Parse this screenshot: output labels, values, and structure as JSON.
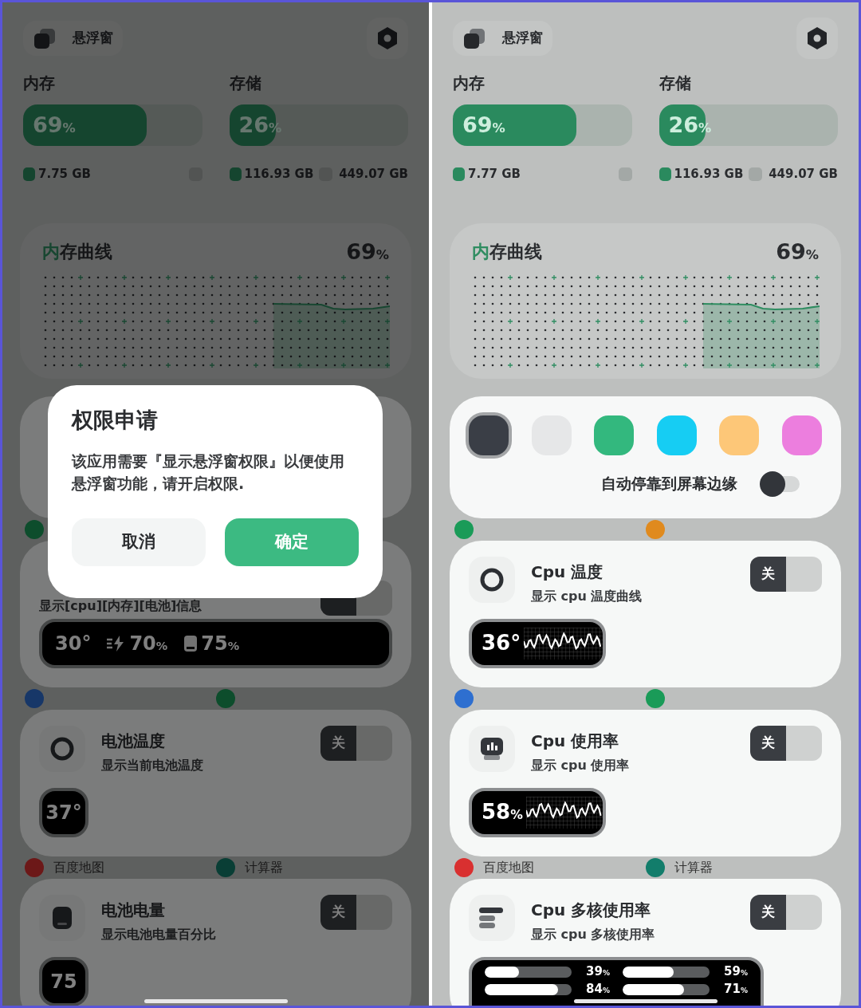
{
  "panels": [
    {
      "dimmed": true,
      "header": {
        "title": "悬浮窗"
      },
      "memory": {
        "label": "内存",
        "level": 0.69,
        "value": "69",
        "unit": "%",
        "used": "7.75 GB"
      },
      "storage": {
        "label": "存储",
        "level": 0.26,
        "value": "26",
        "unit": "%",
        "used": "116.93 GB",
        "total": "449.07 GB"
      },
      "curve": {
        "title": "内存曲线",
        "value": "69",
        "unit": "%"
      },
      "sections": [
        {
          "kind": "blank"
        },
        {
          "kind": "apps",
          "apps": [
            {
              "color": "#0d4d2c"
            }
          ]
        },
        {
          "kind": "widget",
          "subtitle": "显示[cpu][内存][电池]信息",
          "toggle": {
            "on": false
          },
          "preview": {
            "kind": "combo",
            "segments": [
              {
                "kind": "temp",
                "value": "30°"
              },
              {
                "kind": "charge",
                "value": "70",
                "unit": "%"
              },
              {
                "kind": "battery",
                "value": "75",
                "unit": "%"
              }
            ]
          }
        },
        {
          "kind": "apps",
          "apps": [
            {
              "color": "#173768"
            },
            {
              "color": "#0d4d2c"
            }
          ]
        },
        {
          "kind": "ring",
          "title": "电池温度",
          "subtitle": "显示当前电池温度",
          "toggle": {
            "on": false,
            "label": "关"
          },
          "preview": {
            "kind": "badge",
            "value": "37°"
          }
        },
        {
          "kind": "apps",
          "apps": [
            {
              "color": "#6c1818",
              "label": "百度地图"
            },
            {
              "color": "#093e35",
              "label": "计算器"
            }
          ]
        },
        {
          "kind": "battery",
          "title": "电池电量",
          "subtitle": "显示电池电量百分比",
          "toggle": {
            "on": false,
            "label": "关"
          },
          "preview": {
            "kind": "badge",
            "value": "75"
          }
        }
      ],
      "dialog": {
        "title": "权限申请",
        "body": "该应用需要『显示悬浮窗权限』以便使用悬浮窗功能，请开启权限.",
        "buttons": [
          {
            "label": "取消",
            "kind": "secondary"
          },
          {
            "label": "确定",
            "kind": "primary"
          }
        ]
      }
    },
    {
      "dimmed": false,
      "header": {
        "title": "悬浮窗"
      },
      "memory": {
        "label": "内存",
        "level": 0.69,
        "value": "69",
        "unit": "%",
        "used": "7.77 GB"
      },
      "storage": {
        "label": "存储",
        "level": 0.26,
        "value": "26",
        "unit": "%",
        "used": "116.93 GB",
        "total": "449.07 GB"
      },
      "curve": {
        "title": "内存曲线",
        "value": "69",
        "unit": "%"
      },
      "sections": [
        {
          "kind": "swatches",
          "swatches": [
            {
              "color": "#3a3e46",
              "selected": true
            },
            {
              "color": "#e6e7e8",
              "selected": false
            },
            {
              "color": "#33b87e",
              "selected": false
            },
            {
              "color": "#16cdf3",
              "selected": false
            },
            {
              "color": "#fdc778",
              "selected": false
            },
            {
              "color": "#ec7ede",
              "selected": false
            }
          ],
          "dock": {
            "label": "自动停靠到屏幕边缘",
            "on": false
          }
        },
        {
          "kind": "apps",
          "apps": [
            {
              "color": "#1a9b58"
            },
            {
              "color": "#e08a1e"
            }
          ]
        },
        {
          "kind": "ring",
          "title": "Cpu 温度",
          "subtitle": "显示 cpu 温度曲线",
          "toggle": {
            "on": false,
            "label": "关"
          },
          "preview": {
            "kind": "wave",
            "value": "36°"
          }
        },
        {
          "kind": "apps",
          "apps": [
            {
              "color": "#2e6fd0"
            },
            {
              "color": "#1a9b58"
            }
          ]
        },
        {
          "kind": "chart",
          "title": "Cpu 使用率",
          "subtitle": "显示 cpu 使用率",
          "toggle": {
            "on": false,
            "label": "关"
          },
          "preview": {
            "kind": "wave",
            "value": "58",
            "unit": "%"
          }
        },
        {
          "kind": "apps",
          "apps": [
            {
              "color": "#d93030",
              "label": "百度地图"
            },
            {
              "color": "#127d6b",
              "label": "计算器"
            }
          ]
        },
        {
          "kind": "bars",
          "title": "Cpu 多核使用率",
          "subtitle": "显示 cpu 多核使用率",
          "toggle": {
            "on": false,
            "label": "关"
          },
          "preview": {
            "kind": "cores",
            "cores": [
              {
                "level": 0.39,
                "value": "39",
                "unit": "%"
              },
              {
                "level": 0.59,
                "value": "59",
                "unit": "%"
              },
              {
                "level": 0.84,
                "value": "84",
                "unit": "%"
              },
              {
                "level": 0.71,
                "value": "71",
                "unit": "%"
              }
            ]
          }
        }
      ]
    }
  ]
}
